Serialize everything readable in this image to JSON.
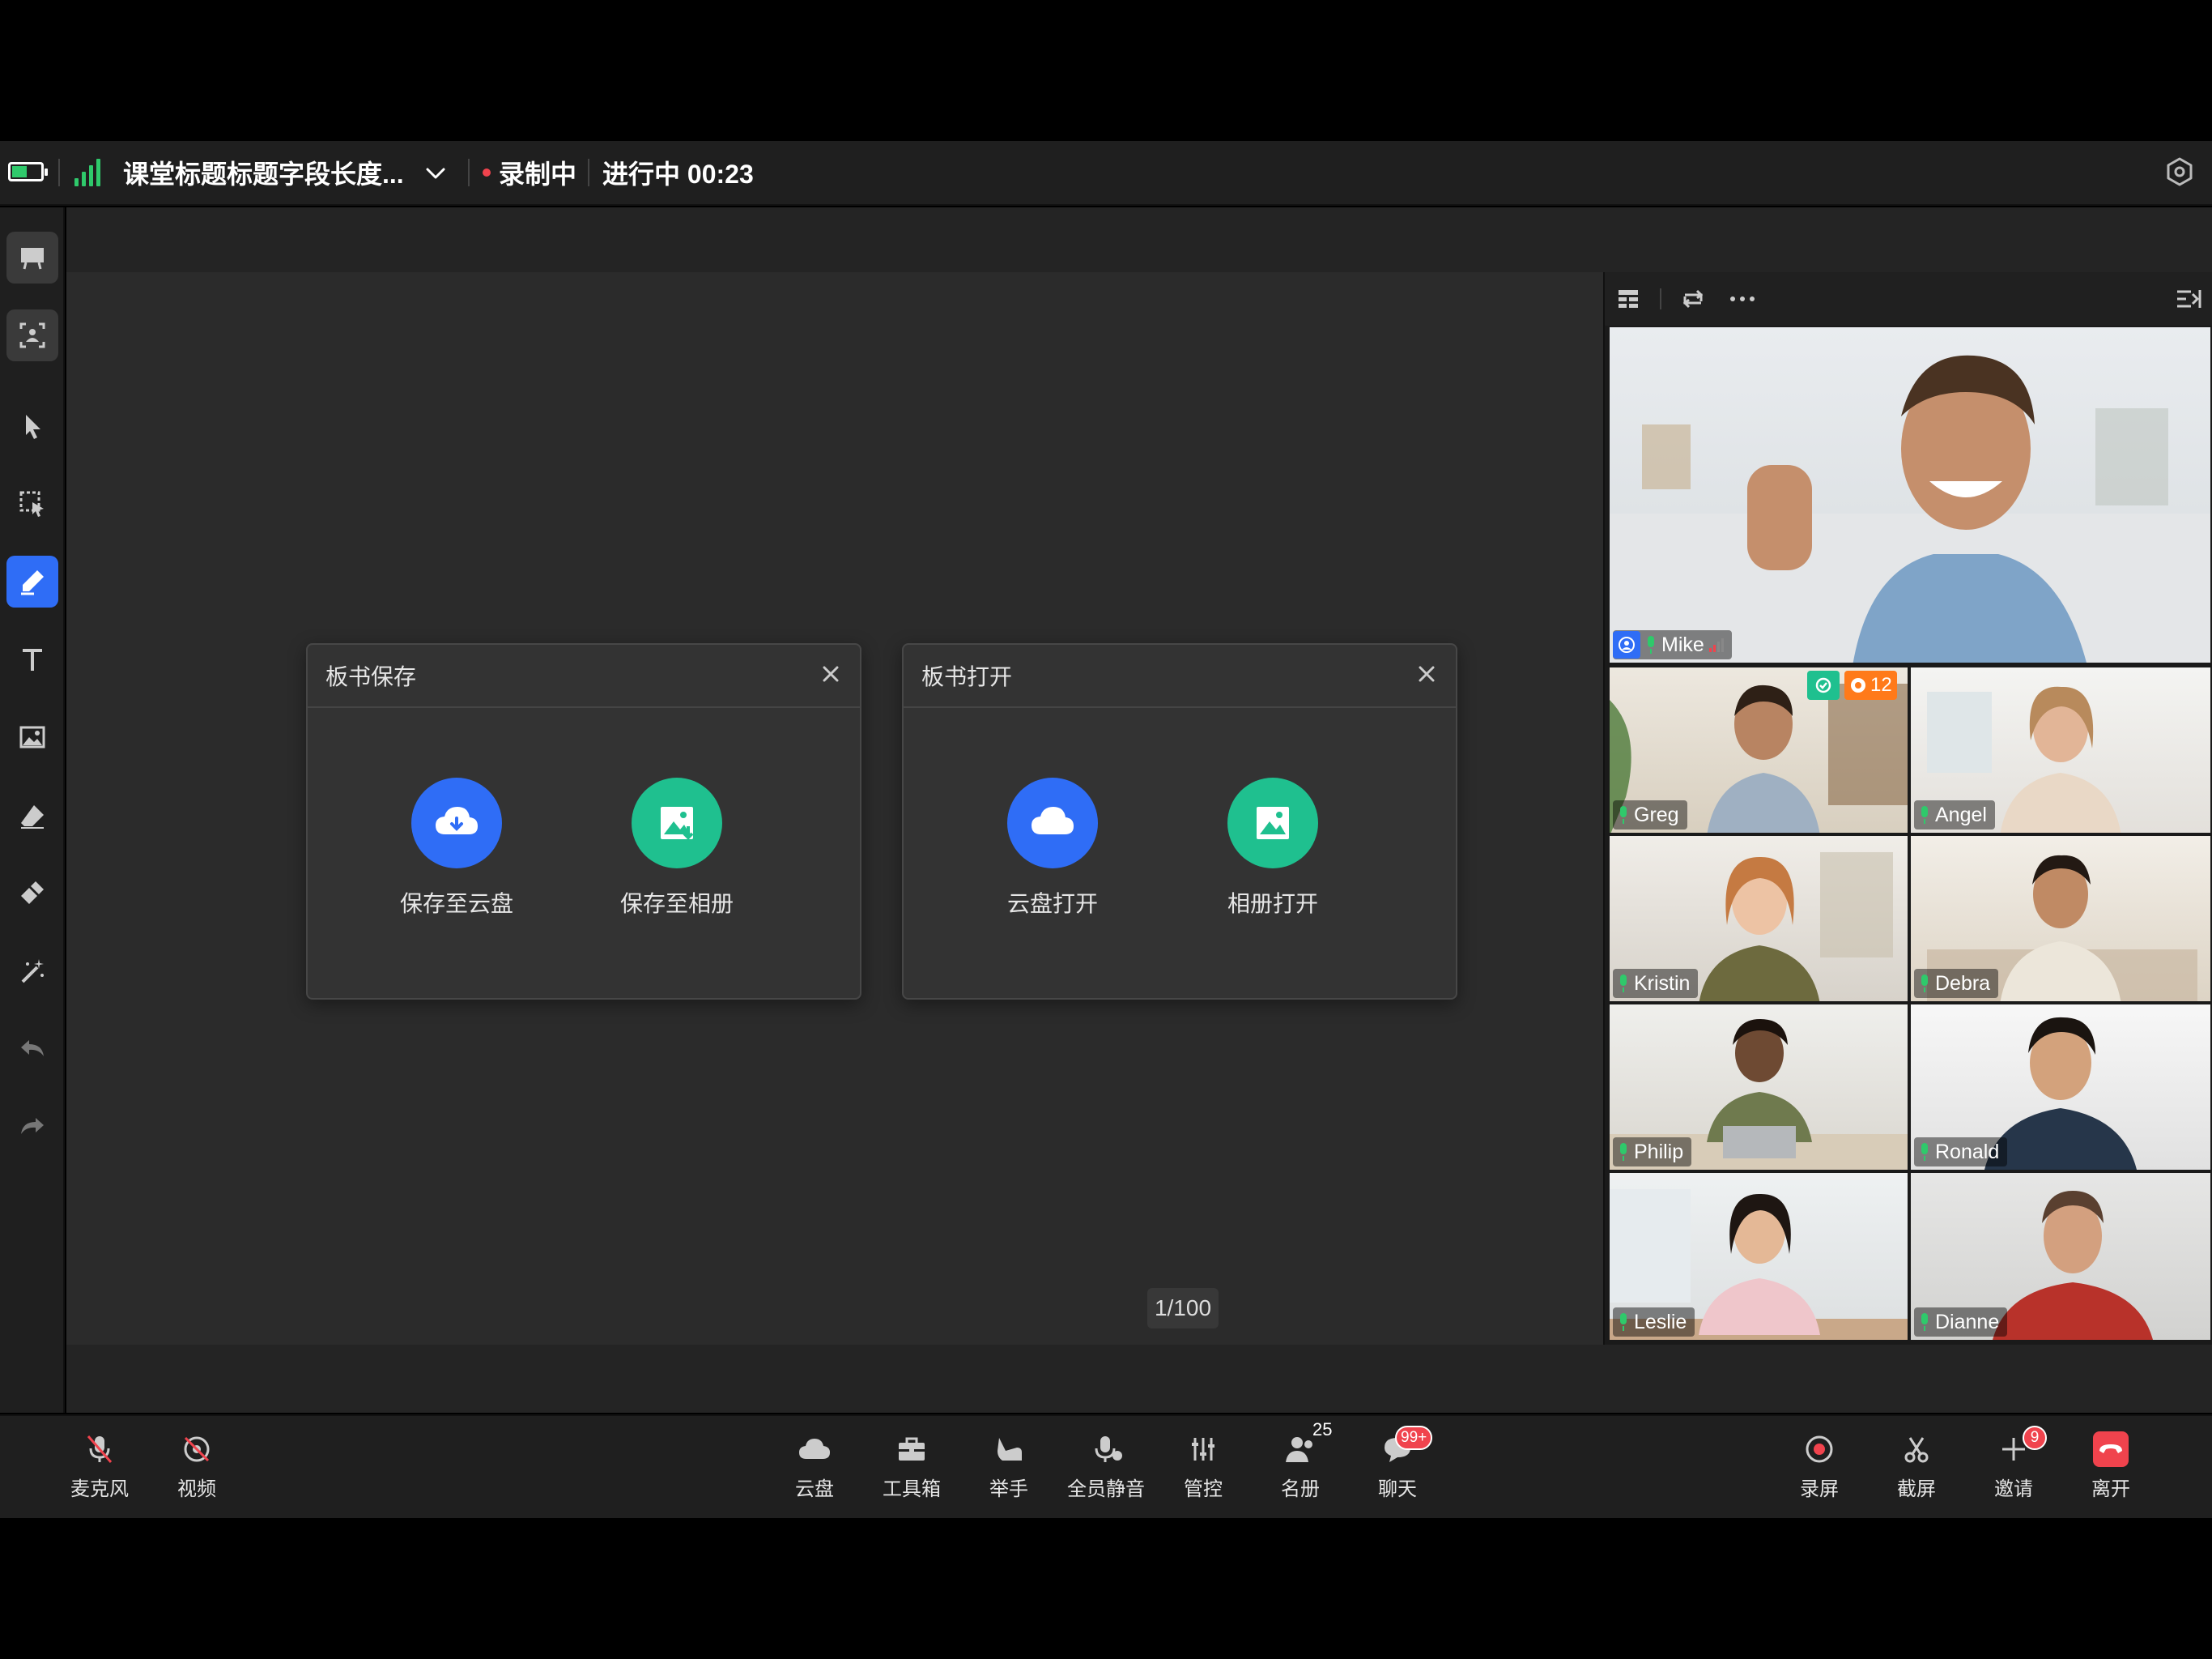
{
  "status_bar": {
    "class_title": "课堂标题标题字段长度...",
    "recording": "录制中",
    "progress": "进行中 00:23",
    "signal_level": 4,
    "battery_level": 0.5
  },
  "dialogs": {
    "save": {
      "title": "板书保存",
      "options": [
        "保存至云盘",
        "保存至相册"
      ]
    },
    "open": {
      "title": "板书打开",
      "options": [
        "云盘打开",
        "相册打开"
      ]
    }
  },
  "page_indicator": "1/100",
  "participants": {
    "main": {
      "name": "Mike"
    },
    "greg": {
      "name": "Greg",
      "badge_count": "12"
    },
    "angel": {
      "name": "Angel"
    },
    "kristin": {
      "name": "Kristin"
    },
    "debra": {
      "name": "Debra"
    },
    "philip": {
      "name": "Philip"
    },
    "ronald": {
      "name": "Ronald"
    },
    "leslie": {
      "name": "Leslie"
    },
    "dianne": {
      "name": "Dianne"
    }
  },
  "bottom_bar": {
    "mic": "麦克风",
    "video": "视频",
    "cloud": "云盘",
    "toolbox": "工具箱",
    "raise_hand": "举手",
    "mute_all": "全员静音",
    "control": "管控",
    "roster": "名册",
    "roster_count": "25",
    "chat": "聊天",
    "chat_badge": "99+",
    "record": "录屏",
    "screenshot": "截屏",
    "invite": "邀请",
    "invite_badge": "9",
    "leave": "离开"
  },
  "colors": {
    "accent_blue": "#2f6df6",
    "accent_green": "#1fc08f",
    "alert_red": "#f0434d",
    "signal_green": "#2fc96b"
  }
}
